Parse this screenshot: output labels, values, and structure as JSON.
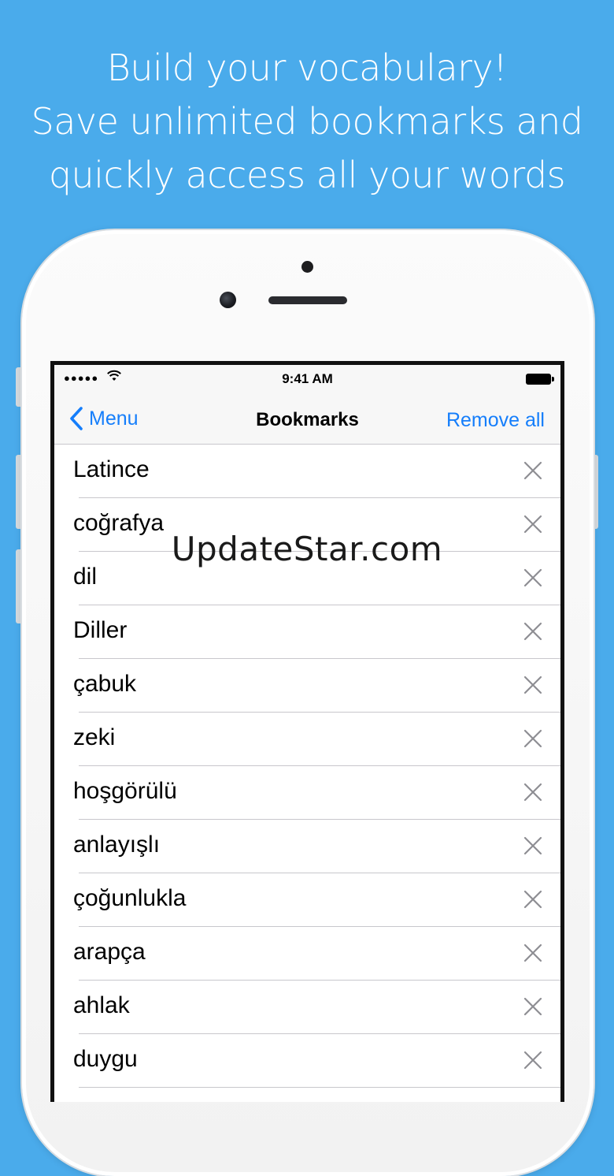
{
  "headline": {
    "line1": "Build your vocabulary!",
    "line2": "Save unlimited bookmarks and",
    "line3": "quickly access all your words"
  },
  "status_bar": {
    "signal": "●●●●●",
    "wifi_icon": "wifi-icon",
    "time": "9:41 AM",
    "battery_icon": "battery-icon"
  },
  "nav": {
    "back_label": "Menu",
    "title": "Bookmarks",
    "action_label": "Remove all"
  },
  "bookmarks": [
    "Latince",
    "coğrafya",
    "dil",
    "Diller",
    "çabuk",
    "zeki",
    "hoşgörülü",
    "anlayışlı",
    "çoğunlukla",
    "arapça",
    "ahlak",
    "duygu"
  ],
  "watermark": "UpdateStar.com",
  "colors": {
    "background": "#4AABEB",
    "accent": "#157EFB"
  }
}
